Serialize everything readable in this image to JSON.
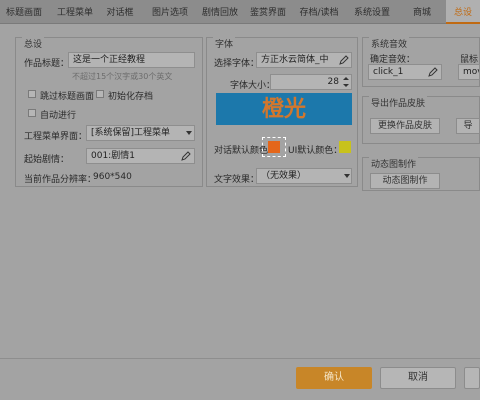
{
  "tabs": [
    {
      "label": "标题画面"
    },
    {
      "label": "工程菜单"
    },
    {
      "label": "对话框"
    },
    {
      "label": "图片选项"
    },
    {
      "label": "剧情回放"
    },
    {
      "label": "鉴赏界面"
    },
    {
      "label": "存档/读档"
    },
    {
      "label": "系统设置"
    },
    {
      "label": "商城"
    },
    {
      "label": "总设"
    }
  ],
  "general": {
    "title": "总设",
    "work_title_label": "作品标题：",
    "work_title_value": "这是一个正经教程",
    "work_title_hint": "不超过15个汉字或30个英文",
    "skip_title_label": "跳过标题画面",
    "init_save_label": "初始化存档",
    "auto_run_label": "自动进行",
    "project_menu_label": "工程菜单界面：",
    "project_menu_value": "[系统保留]工程菜单",
    "start_plot_label": "起始剧情：",
    "start_plot_value": "001:剧情1",
    "resolution_label": "当前作品分辨率：",
    "resolution_value": "960*540"
  },
  "font": {
    "title": "字体",
    "select_font_label": "选择字体：",
    "select_font_value": "方正水云简体_中",
    "font_size_label": "字体大小：",
    "font_size_value": "28",
    "preview_text": "橙光",
    "dialog_color_label": "对话默认颜色：",
    "ui_color_label": "UI默认颜色：",
    "text_effect_label": "文字效果：",
    "text_effect_value": "（无效果）",
    "dialog_color": "#e4661a",
    "ui_color": "#c8c21c"
  },
  "sound": {
    "title": "系统音效",
    "confirm_label": "确定音效：",
    "confirm_value": "click_1",
    "mouse_label": "鼠标",
    "mouse_value": "move"
  },
  "skin": {
    "title": "导出作品皮肤",
    "change_button": "更换作品皮肤",
    "export_button": "导"
  },
  "dynamic": {
    "title": "动态图制作",
    "button": "动态图制作"
  },
  "footer": {
    "confirm": "确认",
    "cancel": "取消"
  }
}
